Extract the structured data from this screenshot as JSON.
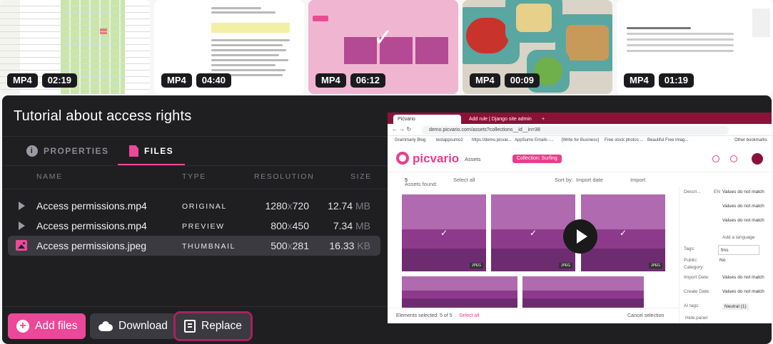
{
  "thumbnails": [
    {
      "format": "MP4",
      "duration": "02:19",
      "selected": false,
      "kind": "spreadsheet"
    },
    {
      "format": "MP4",
      "duration": "04:40",
      "selected": false,
      "kind": "document"
    },
    {
      "format": "MP4",
      "duration": "06:12",
      "selected": true,
      "kind": "app"
    },
    {
      "format": "MP4",
      "duration": "00:09",
      "selected": false,
      "kind": "food"
    },
    {
      "format": "MP4",
      "duration": "01:19",
      "selected": false,
      "kind": "sheet"
    }
  ],
  "panel": {
    "title": "Tutorial about access rights",
    "tabs": {
      "properties": "PROPERTIES",
      "files": "FILES"
    },
    "columns": {
      "name": "NAME",
      "type": "TYPE",
      "resolution": "RESOLUTION",
      "size": "SIZE"
    },
    "files": [
      {
        "name": "Access permissions.mp4",
        "type": "ORIGINAL",
        "width": "1280",
        "height": "720",
        "size": "12.74",
        "unit": "MB",
        "icon": "play-icon"
      },
      {
        "name": "Access permissions.mp4",
        "type": "PREVIEW",
        "width": "800",
        "height": "450",
        "size": "7.34",
        "unit": "MB",
        "icon": "play-icon"
      },
      {
        "name": "Access permissions.jpeg",
        "type": "THUMBNAIL",
        "width": "500",
        "height": "281",
        "size": "16.33",
        "unit": "KB",
        "icon": "image-icon"
      }
    ],
    "times": "x",
    "buttons": {
      "add": "Add files",
      "download": "Download",
      "replace": "Replace"
    }
  },
  "preview": {
    "browser_tabs": [
      "Picvario",
      "Add rule | Django site admin"
    ],
    "new_tab": "+",
    "url": "demo.picvario.com/assets?collections__id__in=38",
    "bookmarks": [
      "Grammarly Blog",
      "testappsumo2",
      "https://demo.picvar...",
      "AppSumo Emails -...",
      "[Write for Business]",
      "Free stock photos ...",
      "Beautiful Free Imag...",
      "Other bookmarks"
    ],
    "logo": "picvario",
    "assets_label": "Assets",
    "collection_chip": "Collection: Surfing",
    "toolbar": {
      "found_label": "Assets found:",
      "found_count": "5",
      "select_all": "Select all",
      "sort_by": "Sort by:",
      "sort_value": "Import date",
      "import": "Import"
    },
    "tiles": [
      {
        "tag": "",
        "checked": true
      },
      {
        "tag": "",
        "checked": true
      },
      {
        "tag": "",
        "checked": true
      },
      {
        "tag": "",
        "checked": false
      },
      {
        "tag": "",
        "checked": false
      }
    ],
    "jpeg_tags": [
      "JPEG",
      "JPEG",
      "JPEG"
    ],
    "sidebar": {
      "descr_label": "Descri...",
      "lang_en": "EN",
      "values_mismatch": "Values do not match",
      "add_language": "Add a language",
      "tags_label": "Tags:",
      "tag_input": "fms",
      "public_label": "Public:",
      "public_value": "No",
      "category_label": "Category:",
      "import_date_label": "Import Date:",
      "create_date_label": "Create Date:",
      "ai_tags_label": "AI tags:",
      "ai_tag": "Neutral (1)",
      "hide_panel": "Hide panel"
    },
    "footer": {
      "selected": "Elements selected: 5 of 5",
      "select_all": "Select all",
      "cancel": "Cancel selection"
    }
  },
  "colors": {
    "accent": "#ec4899",
    "panel_bg": "#1f1f22",
    "selected_row": "#3a3a40",
    "replace_outline": "#a3245e"
  }
}
